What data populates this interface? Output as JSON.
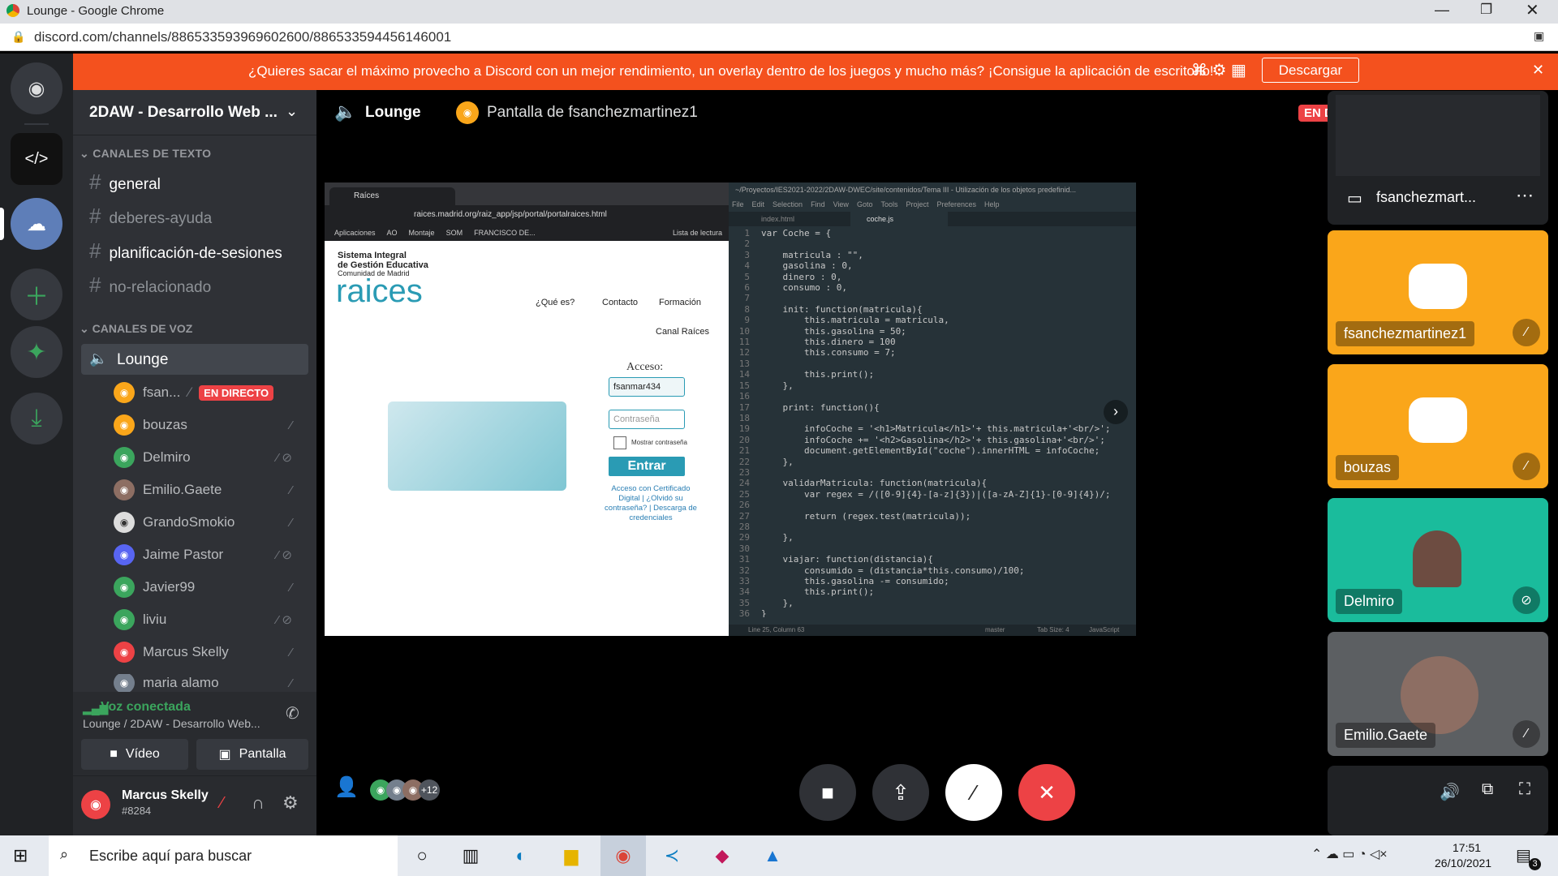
{
  "window": {
    "title": "Lounge - Google Chrome",
    "url": "discord.com/channels/886533593969602600/886533594456146001"
  },
  "banner": {
    "text": "¿Quieres sacar el máximo provecho a Discord con un mejor rendimiento, un overlay dentro de los juegos y mucho más? ¡Consigue la aplicación de escritorio!",
    "button": "Descargar"
  },
  "server": {
    "name": "2DAW - Desarrollo Web ..."
  },
  "text_channels": {
    "header": "CANALES DE TEXTO",
    "items": [
      "general",
      "deberes-ayuda",
      "planificación-de-sesiones",
      "no-relacionado"
    ]
  },
  "voice_channels": {
    "header": "CANALES DE VOZ",
    "lounge": "Lounge",
    "live_badge": "EN DIRECTO",
    "users": [
      "fsan...",
      "bouzas",
      "Delmiro",
      "Emilio.Gaete",
      "GrandoSmokio",
      "Jaime Pastor",
      "Javier99",
      "liviu",
      "Marcus Skelly",
      "maria alamo"
    ]
  },
  "voice_status": {
    "title": "Voz conectada",
    "subtitle": "Lounge / 2DAW - Desarrollo Web...",
    "video": "Vídeo",
    "screen": "Pantalla"
  },
  "account": {
    "name": "Marcus Skelly",
    "tag": "#8284"
  },
  "header": {
    "channel": "Lounge",
    "stream": "Pantalla de fsanchezmartinez1",
    "live": "EN DIRECTO"
  },
  "members": {
    "more": "+12"
  },
  "tiles": {
    "stream_owner": "fsanchezmart...",
    "t1": "fsanchezmartinez1",
    "t2": "bouzas",
    "t3": "Delmiro",
    "t4": "Emilio.Gaete"
  },
  "stream": {
    "tab": "Raíces",
    "url": "raices.madrid.org/raiz_app/jsp/portal/portalraices.html",
    "bookmarks": [
      "Aplicaciones",
      "AO",
      "Montaje",
      "SOM",
      "FRANCISCO DE..."
    ],
    "reading_list": "Lista de lectura",
    "sig1": "Sistema Integral",
    "sig2": "de Gestión Educativa",
    "sig3": "Comunidad de Madrid",
    "logo": "raices",
    "nav": [
      "¿Qué es?",
      "Contacto",
      "Formación",
      "Canal Raíces"
    ],
    "login_title": "Acceso:",
    "user_value": "fsanmar434",
    "pass_placeholder": "Contraseña",
    "show_pass": "Mostrar contraseña",
    "enter": "Entrar",
    "links": "Acceso con Certificado Digital | ¿Olvidó su contraseña? | Descarga de credenciales",
    "editor_title": "~/Proyectos/IES2021-2022/2DAW-DWEC/site/contenidos/Tema III - Utilización de los objetos predefinid...",
    "menu": [
      "File",
      "Edit",
      "Selection",
      "Find",
      "View",
      "Goto",
      "Tools",
      "Project",
      "Preferences",
      "Help"
    ],
    "tabs": [
      "index.html",
      "coche.js"
    ],
    "code": "var Coche = {\n\n    matricula : \"\",\n    gasolina : 0,\n    dinero : 0,\n    consumo : 0,\n\n    init: function(matricula){\n        this.matricula = matricula,\n        this.gasolina = 50;\n        this.dinero = 100\n        this.consumo = 7;\n\n        this.print();\n    },\n\n    print: function(){\n\n        infoCoche = '<h1>Matricula</h1>'+ this.matricula+'<br/>';\n        infoCoche += '<h2>Gasolina</h2>'+ this.gasolina+'<br/>';\n        document.getElementById(\"coche\").innerHTML = infoCoche;\n    },\n\n    validarMatricula: function(matricula){\n        var regex = /([0-9]{4}-[a-z]{3})|([a-zA-Z]{1}-[0-9]{4})/;\n\n        return (regex.test(matricula));\n\n    },\n\n    viajar: function(distancia){\n        consumido = (distancia*this.consumo)/100;\n        this.gasolina -= consumido;\n        this.print();\n    },\n}",
    "status": "Line 25, Column 63",
    "branch": "master",
    "tab_size": "Tab Size: 4",
    "lang": "JavaScript"
  },
  "taskbar": {
    "search": "Escribe aquí para buscar",
    "time": "17:51",
    "date": "26/10/2021",
    "notif": "3"
  },
  "colors": {
    "brand": "#5865f2",
    "live": "#ed4245",
    "orange": "#faa61a",
    "green": "#3ba55d",
    "teal": "#1abc9c"
  }
}
